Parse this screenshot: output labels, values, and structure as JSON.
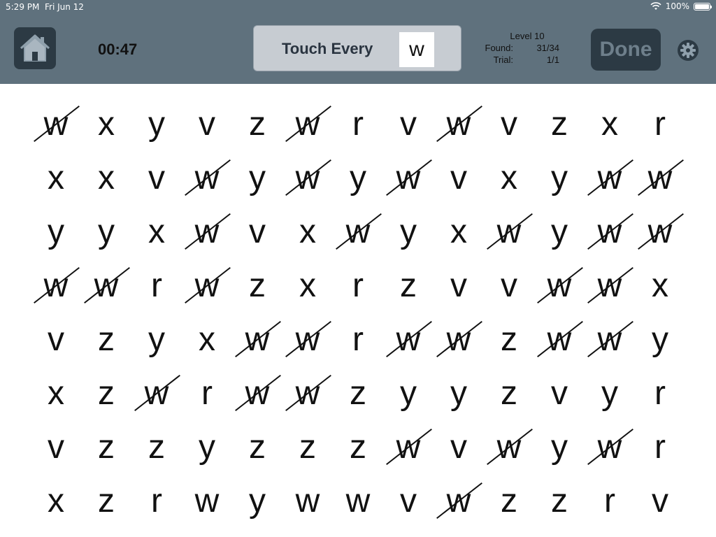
{
  "status_bar": {
    "time": "5:29 PM",
    "date": "Fri Jun 12",
    "battery": "100%"
  },
  "toolbar": {
    "timer": "00:47",
    "target_label": "Touch Every",
    "target_letter": "w",
    "level": "Level 10",
    "found_label": "Found:",
    "found_value": "31/34",
    "trial_label": "Trial:",
    "trial_value": "1/1",
    "done_label": "Done"
  },
  "colors": {
    "toolbar": "#5f717d",
    "button_dark": "#2c3a44",
    "target_box": "#c7ccd2"
  },
  "grid": {
    "rows": [
      [
        "w",
        "x",
        "y",
        "v",
        "z",
        "w",
        "r",
        "v",
        "w",
        "v",
        "z",
        "x",
        "r"
      ],
      [
        "x",
        "x",
        "v",
        "w",
        "y",
        "w",
        "y",
        "w",
        "v",
        "x",
        "y",
        "w",
        "w"
      ],
      [
        "y",
        "y",
        "x",
        "w",
        "v",
        "x",
        "w",
        "y",
        "x",
        "w",
        "y",
        "w",
        "w"
      ],
      [
        "w",
        "w",
        "r",
        "w",
        "z",
        "x",
        "r",
        "z",
        "v",
        "v",
        "w",
        "w",
        "x"
      ],
      [
        "v",
        "z",
        "y",
        "x",
        "w",
        "w",
        "r",
        "w",
        "w",
        "z",
        "w",
        "w",
        "y"
      ],
      [
        "x",
        "z",
        "w",
        "r",
        "w",
        "w",
        "z",
        "y",
        "y",
        "z",
        "v",
        "y",
        "r"
      ],
      [
        "v",
        "z",
        "z",
        "y",
        "z",
        "z",
        "z",
        "w",
        "v",
        "w",
        "y",
        "w",
        "r"
      ],
      [
        "x",
        "z",
        "r",
        "w",
        "y",
        "w",
        "w",
        "v",
        "w",
        "z",
        "z",
        "r",
        "v"
      ]
    ],
    "marked": [
      [
        1,
        0,
        0,
        0,
        0,
        1,
        0,
        0,
        1,
        0,
        0,
        0,
        0
      ],
      [
        0,
        0,
        0,
        1,
        0,
        1,
        0,
        1,
        0,
        0,
        0,
        1,
        1
      ],
      [
        0,
        0,
        0,
        1,
        0,
        0,
        1,
        0,
        0,
        1,
        0,
        1,
        1
      ],
      [
        1,
        1,
        0,
        1,
        0,
        0,
        0,
        0,
        0,
        0,
        1,
        1,
        0
      ],
      [
        0,
        0,
        0,
        0,
        1,
        1,
        0,
        1,
        1,
        0,
        1,
        1,
        0
      ],
      [
        0,
        0,
        1,
        0,
        1,
        1,
        0,
        0,
        0,
        0,
        0,
        0,
        0
      ],
      [
        0,
        0,
        0,
        0,
        0,
        0,
        0,
        1,
        0,
        1,
        0,
        1,
        0
      ],
      [
        0,
        0,
        0,
        0,
        0,
        0,
        0,
        0,
        1,
        0,
        0,
        0,
        0
      ]
    ]
  }
}
